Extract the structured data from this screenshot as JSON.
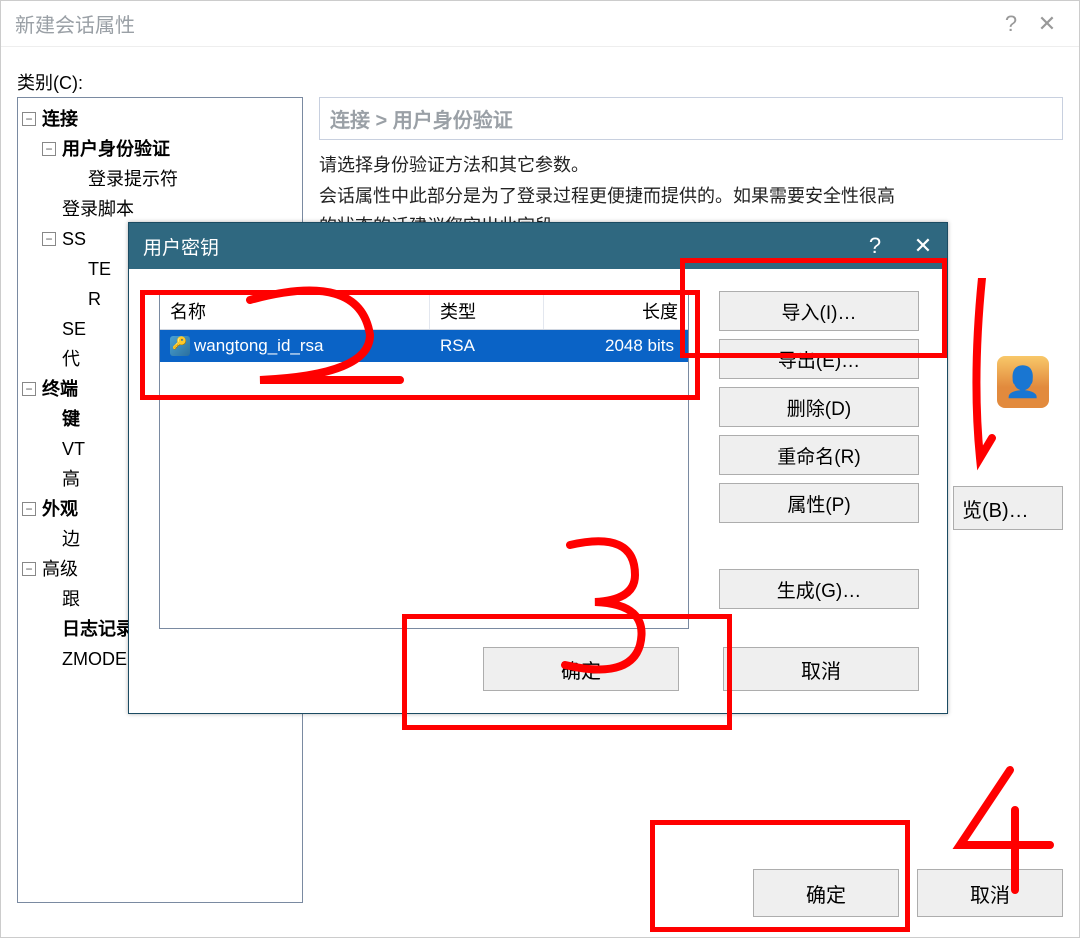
{
  "main": {
    "title": "新建会话属性",
    "help_icon": "?",
    "close_icon": "✕",
    "category_label": "类别(C):",
    "breadcrumb": "连接 > 用户身份验证",
    "instr_line1": "请选择身份验证方法和其它参数。",
    "instr_line2_a": "会话属性中此部分是为了登录过程更便捷而提供的。如果需要安全性很高",
    "instr_line2_b": "的状态的话建议您空出此字段。",
    "browse_label": "览(B)…",
    "ok_label": "确定",
    "cancel_label": "取消"
  },
  "tree": {
    "connection": "连接",
    "user_auth": "用户身份验证",
    "login_prompt": "登录提示符",
    "login_script": "登录脚本",
    "ss": "SS",
    "tE": "TE",
    "r": "R",
    "se": "SE",
    "proxy": "代",
    "terminal": "终端",
    "keyT": "键",
    "vt": "VT",
    "adv": "高",
    "appearance": "外观",
    "margin": "边",
    "advanced": "高级",
    "trace": "跟",
    "log": "日志记录",
    "zmodem": "ZMODEM"
  },
  "keydlg": {
    "title": "用户密钥",
    "help_icon": "?",
    "close_icon": "✕",
    "col_name": "名称",
    "col_type": "类型",
    "col_len": "长度",
    "rows": [
      {
        "name": "wangtong_id_rsa",
        "type": "RSA",
        "len": "2048 bits"
      }
    ],
    "btn_import": "导入(I)…",
    "btn_export": "导出(E)…",
    "btn_delete": "删除(D)",
    "btn_rename": "重命名(R)",
    "btn_prop": "属性(P)",
    "btn_gen": "生成(G)…",
    "btn_ok": "确定",
    "btn_cancel": "取消"
  }
}
